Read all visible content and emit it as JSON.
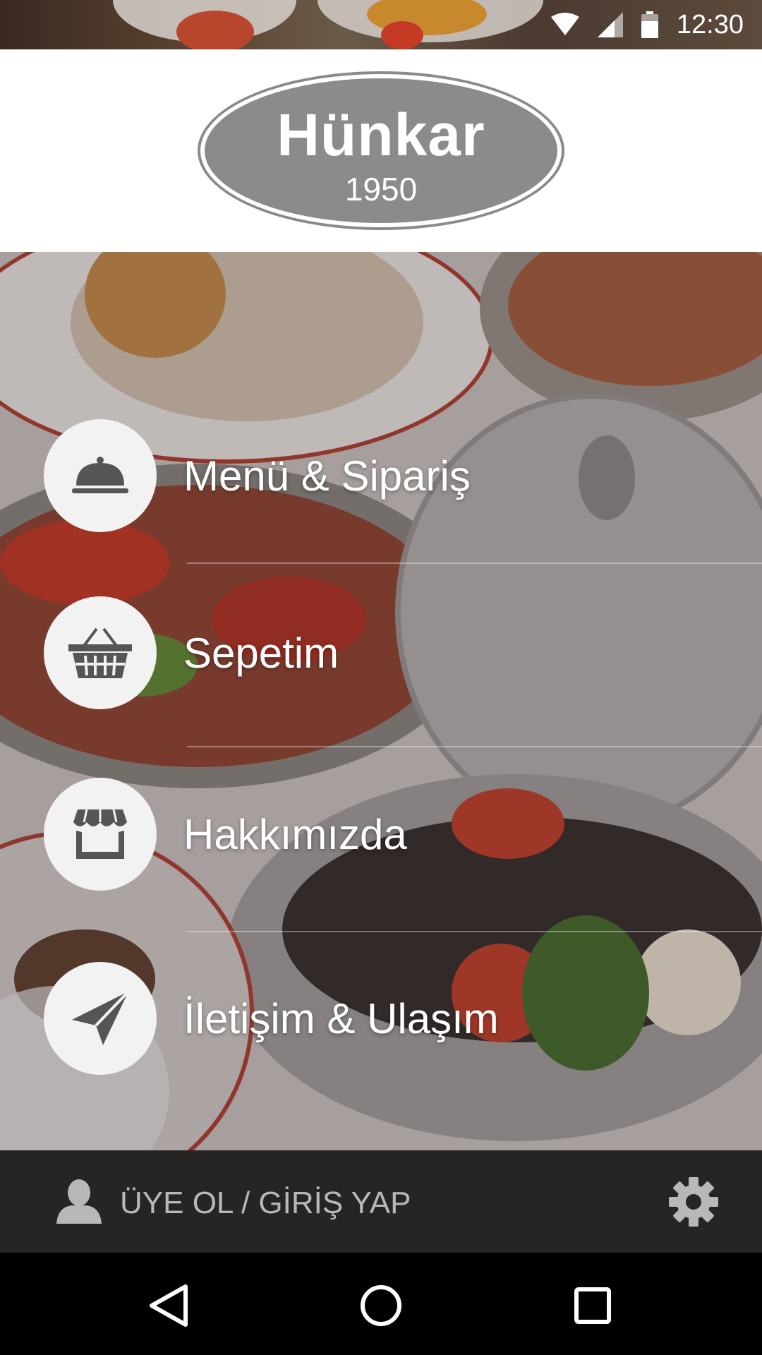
{
  "status_bar": {
    "time": "12:30",
    "icons": [
      "wifi-icon",
      "signal-icon",
      "battery-icon"
    ]
  },
  "logo": {
    "name": "Hünkar",
    "year": "1950"
  },
  "menu": [
    {
      "label": "Menü & Sipariş",
      "icon": "cloche-icon"
    },
    {
      "label": "Sepetim",
      "icon": "basket-icon"
    },
    {
      "label": "Hakkımızda",
      "icon": "store-icon"
    },
    {
      "label": "İletişim & Ulaşım",
      "icon": "paper-plane-icon"
    }
  ],
  "login_bar": {
    "label": "ÜYE OL / GİRİŞ YAP",
    "icons": [
      "user-icon",
      "gear-icon"
    ]
  },
  "nav_bar": {
    "icons": [
      "back-icon",
      "home-icon",
      "recents-icon"
    ]
  },
  "colors": {
    "bottom_bar": "#272424",
    "circle": "#f3f2f2",
    "logo_gray": "#8b8b8b"
  }
}
